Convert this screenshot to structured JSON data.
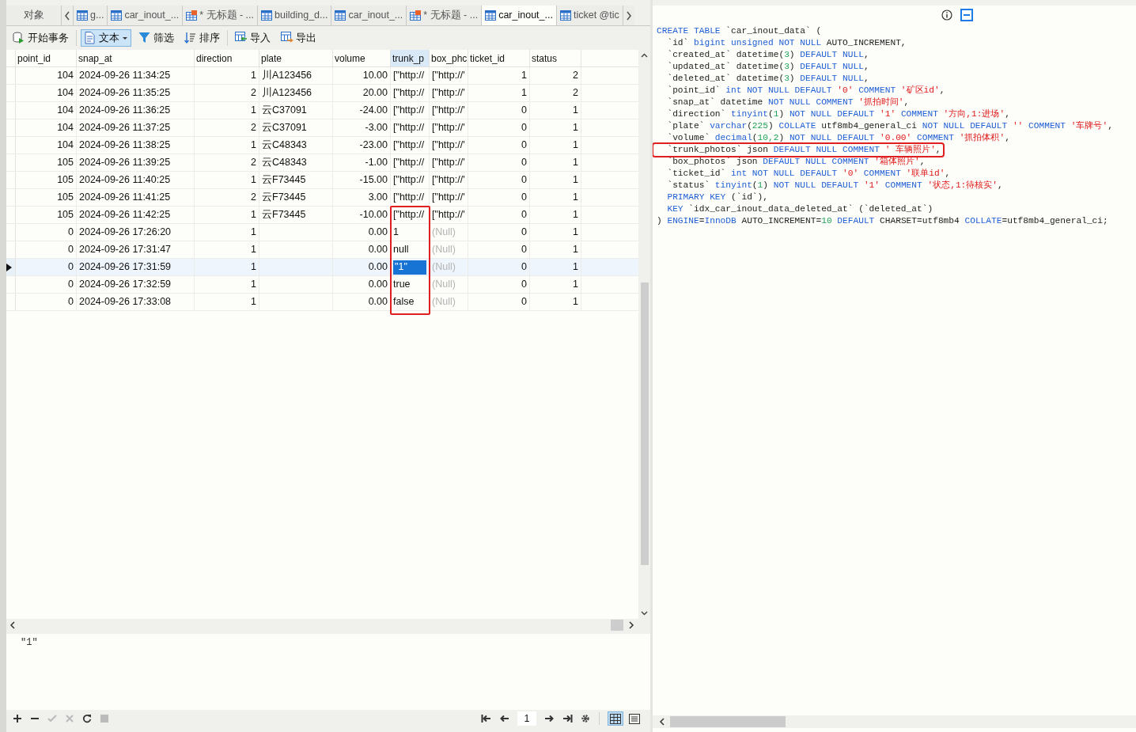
{
  "tabs": [
    {
      "label": "对象",
      "kind": "objects",
      "selected": false
    },
    {
      "label": "g...",
      "kind": "table",
      "selected": false
    },
    {
      "label": "car_inout_...",
      "kind": "table",
      "selected": false
    },
    {
      "label": "* 无标题 - ...",
      "kind": "query",
      "selected": false
    },
    {
      "label": "building_d...",
      "kind": "table",
      "selected": false
    },
    {
      "label": "car_inout_...",
      "kind": "table",
      "selected": false
    },
    {
      "label": "* 无标题 - ...",
      "kind": "query",
      "selected": false
    },
    {
      "label": "car_inout_...",
      "kind": "table",
      "selected": true
    },
    {
      "label": "ticket @tic",
      "kind": "table",
      "selected": false
    }
  ],
  "toolbar": [
    {
      "label": "开始事务",
      "kind": "transaction",
      "pressed": false
    },
    {
      "label": "文本",
      "kind": "text",
      "pressed": true
    },
    {
      "label": "筛选",
      "kind": "filter",
      "pressed": false
    },
    {
      "label": "排序",
      "kind": "sort",
      "pressed": false
    },
    {
      "label": "导入",
      "kind": "import",
      "pressed": false
    },
    {
      "label": "导出",
      "kind": "export",
      "pressed": false
    }
  ],
  "table": {
    "columns": [
      "point_id",
      "snap_at",
      "direction",
      "plate",
      "volume",
      "trunk_p",
      "box_phc",
      "ticket_id",
      "status"
    ],
    "rows": [
      {
        "cells": [
          "104",
          "2024-09-26 11:34:25",
          "1",
          "川A123456",
          "10.00",
          "[\"http://",
          "[\"http://'",
          "1",
          "2"
        ],
        "box_null": false,
        "annotated": false,
        "selected": false
      },
      {
        "cells": [
          "104",
          "2024-09-26 11:35:25",
          "2",
          "川A123456",
          "20.00",
          "[\"http://",
          "[\"http://'",
          "1",
          "2"
        ],
        "box_null": false,
        "annotated": false,
        "selected": false
      },
      {
        "cells": [
          "104",
          "2024-09-26 11:36:25",
          "1",
          "云C37091",
          "-24.00",
          "[\"http://",
          "[\"http://'",
          "0",
          "1"
        ],
        "box_null": false,
        "annotated": false,
        "selected": false
      },
      {
        "cells": [
          "104",
          "2024-09-26 11:37:25",
          "2",
          "云C37091",
          "-3.00",
          "[\"http://",
          "[\"http://'",
          "0",
          "1"
        ],
        "box_null": false,
        "annotated": false,
        "selected": false
      },
      {
        "cells": [
          "104",
          "2024-09-26 11:38:25",
          "1",
          "云C48343",
          "-23.00",
          "[\"http://",
          "[\"http://'",
          "0",
          "1"
        ],
        "box_null": false,
        "annotated": false,
        "selected": false
      },
      {
        "cells": [
          "105",
          "2024-09-26 11:39:25",
          "2",
          "云C48343",
          "-1.00",
          "[\"http://",
          "[\"http://'",
          "0",
          "1"
        ],
        "box_null": false,
        "annotated": false,
        "selected": false
      },
      {
        "cells": [
          "105",
          "2024-09-26 11:40:25",
          "1",
          "云F73445",
          "-15.00",
          "[\"http://",
          "[\"http://'",
          "0",
          "1"
        ],
        "box_null": false,
        "annotated": false,
        "selected": false
      },
      {
        "cells": [
          "105",
          "2024-09-26 11:41:25",
          "2",
          "云F73445",
          "3.00",
          "[\"http://",
          "[\"http://'",
          "0",
          "1"
        ],
        "box_null": false,
        "annotated": false,
        "selected": false
      },
      {
        "cells": [
          "105",
          "2024-09-26 11:42:25",
          "1",
          "云F73445",
          "-10.00",
          "[\"http://",
          "[\"http://'",
          "0",
          "1"
        ],
        "box_null": false,
        "annotated": true,
        "selected": false
      },
      {
        "cells": [
          "0",
          "2024-09-26 17:26:20",
          "1",
          null,
          "0.00",
          "1",
          "(Null)",
          "0",
          "1"
        ],
        "box_null": true,
        "annotated": true,
        "selected": false
      },
      {
        "cells": [
          "0",
          "2024-09-26 17:31:47",
          "1",
          null,
          "0.00",
          "null",
          "(Null)",
          "0",
          "1"
        ],
        "box_null": true,
        "annotated": true,
        "selected": false
      },
      {
        "cells": [
          "0",
          "2024-09-26 17:31:59",
          "1",
          null,
          "0.00",
          "\"1\"",
          "(Null)",
          "0",
          "1"
        ],
        "box_null": true,
        "annotated": true,
        "selected": true
      },
      {
        "cells": [
          "0",
          "2024-09-26 17:32:59",
          "1",
          null,
          "0.00",
          "true",
          "(Null)",
          "0",
          "1"
        ],
        "box_null": true,
        "annotated": true,
        "selected": false
      },
      {
        "cells": [
          "0",
          "2024-09-26 17:33:08",
          "1",
          null,
          "0.00",
          "false",
          "(Null)",
          "0",
          "1"
        ],
        "box_null": true,
        "annotated": true,
        "selected": false
      }
    ]
  },
  "editor": {
    "value": "\"1\""
  },
  "pager": {
    "page": "1"
  },
  "views": [
    {
      "kind": "grid",
      "selected": true
    },
    {
      "kind": "form",
      "selected": false
    }
  ],
  "ddl": {
    "lines": [
      {
        "highlight": false,
        "parts": [
          {
            "kind": "k",
            "text": "CREATE TABLE"
          },
          {
            "kind": "p",
            "text": " `car_inout_data` ("
          }
        ]
      },
      {
        "highlight": false,
        "parts": [
          {
            "kind": "p",
            "text": "  `id` "
          },
          {
            "kind": "k",
            "text": "bigint unsigned NOT NULL"
          },
          {
            "kind": "p",
            "text": " AUTO_INCREMENT,"
          }
        ]
      },
      {
        "highlight": false,
        "parts": [
          {
            "kind": "p",
            "text": "  `created_at` datetime("
          },
          {
            "kind": "n",
            "text": "3"
          },
          {
            "kind": "p",
            "text": ") "
          },
          {
            "kind": "k",
            "text": "DEFAULT NULL"
          },
          {
            "kind": "p",
            "text": ","
          }
        ]
      },
      {
        "highlight": false,
        "parts": [
          {
            "kind": "p",
            "text": "  `updated_at` datetime("
          },
          {
            "kind": "n",
            "text": "3"
          },
          {
            "kind": "p",
            "text": ") "
          },
          {
            "kind": "k",
            "text": "DEFAULT NULL"
          },
          {
            "kind": "p",
            "text": ","
          }
        ]
      },
      {
        "highlight": false,
        "parts": [
          {
            "kind": "p",
            "text": "  `deleted_at` datetime("
          },
          {
            "kind": "n",
            "text": "3"
          },
          {
            "kind": "p",
            "text": ") "
          },
          {
            "kind": "k",
            "text": "DEFAULT NULL"
          },
          {
            "kind": "p",
            "text": ","
          }
        ]
      },
      {
        "highlight": false,
        "parts": [
          {
            "kind": "p",
            "text": "  `point_id` "
          },
          {
            "kind": "k",
            "text": "int NOT NULL DEFAULT "
          },
          {
            "kind": "s",
            "text": "'0' "
          },
          {
            "kind": "k",
            "text": "COMMENT "
          },
          {
            "kind": "s",
            "text": "'矿区id'"
          },
          {
            "kind": "p",
            "text": ","
          }
        ]
      },
      {
        "highlight": false,
        "parts": [
          {
            "kind": "p",
            "text": "  `snap_at` datetime "
          },
          {
            "kind": "k",
            "text": "NOT NULL COMMENT "
          },
          {
            "kind": "s",
            "text": "'抓拍时间'"
          },
          {
            "kind": "p",
            "text": ","
          }
        ]
      },
      {
        "highlight": false,
        "parts": [
          {
            "kind": "p",
            "text": "  `direction` "
          },
          {
            "kind": "k",
            "text": "tinyint"
          },
          {
            "kind": "p",
            "text": "("
          },
          {
            "kind": "n",
            "text": "1"
          },
          {
            "kind": "p",
            "text": ") "
          },
          {
            "kind": "k",
            "text": "NOT NULL DEFAULT "
          },
          {
            "kind": "s",
            "text": "'1' "
          },
          {
            "kind": "k",
            "text": "COMMENT "
          },
          {
            "kind": "s",
            "text": "'方向,1:进场'"
          },
          {
            "kind": "p",
            "text": ","
          }
        ]
      },
      {
        "highlight": false,
        "parts": [
          {
            "kind": "p",
            "text": "  `plate` "
          },
          {
            "kind": "k",
            "text": "varchar"
          },
          {
            "kind": "p",
            "text": "("
          },
          {
            "kind": "n",
            "text": "225"
          },
          {
            "kind": "p",
            "text": ") "
          },
          {
            "kind": "k",
            "text": "COLLATE"
          },
          {
            "kind": "p",
            "text": " utf8mb4_general_ci "
          },
          {
            "kind": "k",
            "text": "NOT NULL DEFAULT "
          },
          {
            "kind": "s",
            "text": "'' "
          },
          {
            "kind": "k",
            "text": "COMMENT "
          },
          {
            "kind": "s",
            "text": "'车牌号'"
          },
          {
            "kind": "p",
            "text": ","
          }
        ]
      },
      {
        "highlight": false,
        "parts": [
          {
            "kind": "p",
            "text": "  `volume` "
          },
          {
            "kind": "k",
            "text": "decimal"
          },
          {
            "kind": "p",
            "text": "("
          },
          {
            "kind": "n",
            "text": "10,2"
          },
          {
            "kind": "p",
            "text": ") "
          },
          {
            "kind": "k",
            "text": "NOT NULL DEFAULT "
          },
          {
            "kind": "s",
            "text": "'0.00' "
          },
          {
            "kind": "k",
            "text": "COMMENT "
          },
          {
            "kind": "s",
            "text": "'抓拍体积'"
          },
          {
            "kind": "p",
            "text": ","
          }
        ]
      },
      {
        "highlight": true,
        "parts": [
          {
            "kind": "p",
            "text": "  `trunk_photos` json "
          },
          {
            "kind": "k",
            "text": "DEFAULT NULL COMMENT "
          },
          {
            "kind": "s",
            "text": "' 车辆照片'"
          },
          {
            "kind": "p",
            "text": ","
          }
        ]
      },
      {
        "highlight": false,
        "parts": [
          {
            "kind": "p",
            "text": "  `box_photos` json "
          },
          {
            "kind": "k",
            "text": "DEFAULT NULL COMMENT "
          },
          {
            "kind": "s",
            "text": "'箱体照片'"
          },
          {
            "kind": "p",
            "text": ","
          }
        ]
      },
      {
        "highlight": false,
        "parts": [
          {
            "kind": "p",
            "text": "  `ticket_id` "
          },
          {
            "kind": "k",
            "text": "int NOT NULL DEFAULT "
          },
          {
            "kind": "s",
            "text": "'0' "
          },
          {
            "kind": "k",
            "text": "COMMENT "
          },
          {
            "kind": "s",
            "text": "'联单id'"
          },
          {
            "kind": "p",
            "text": ","
          }
        ]
      },
      {
        "highlight": false,
        "parts": [
          {
            "kind": "p",
            "text": "  `status` "
          },
          {
            "kind": "k",
            "text": "tinyint"
          },
          {
            "kind": "p",
            "text": "("
          },
          {
            "kind": "n",
            "text": "1"
          },
          {
            "kind": "p",
            "text": ") "
          },
          {
            "kind": "k",
            "text": "NOT NULL DEFAULT "
          },
          {
            "kind": "s",
            "text": "'1' "
          },
          {
            "kind": "k",
            "text": "COMMENT "
          },
          {
            "kind": "s",
            "text": "'状态,1:待核实'"
          },
          {
            "kind": "p",
            "text": ","
          }
        ]
      },
      {
        "highlight": false,
        "parts": [
          {
            "kind": "k",
            "text": "  PRIMARY KEY"
          },
          {
            "kind": "p",
            "text": " (`id`),"
          }
        ]
      },
      {
        "highlight": false,
        "parts": [
          {
            "kind": "k",
            "text": "  KEY"
          },
          {
            "kind": "p",
            "text": " `idx_car_inout_data_deleted_at` (`deleted_at`)"
          }
        ]
      },
      {
        "highlight": false,
        "parts": [
          {
            "kind": "p",
            "text": ") "
          },
          {
            "kind": "k",
            "text": "ENGINE"
          },
          {
            "kind": "p",
            "text": "="
          },
          {
            "kind": "k",
            "text": "InnoDB"
          },
          {
            "kind": "p",
            "text": " AUTO_INCREMENT="
          },
          {
            "kind": "n",
            "text": "10"
          },
          {
            "kind": "k",
            "text": " DEFAULT"
          },
          {
            "kind": "p",
            "text": " CHARSET=utf8mb4 "
          },
          {
            "kind": "k",
            "text": "COLLATE"
          },
          {
            "kind": "p",
            "text": "=utf8mb4_general_ci;"
          }
        ]
      }
    ]
  }
}
